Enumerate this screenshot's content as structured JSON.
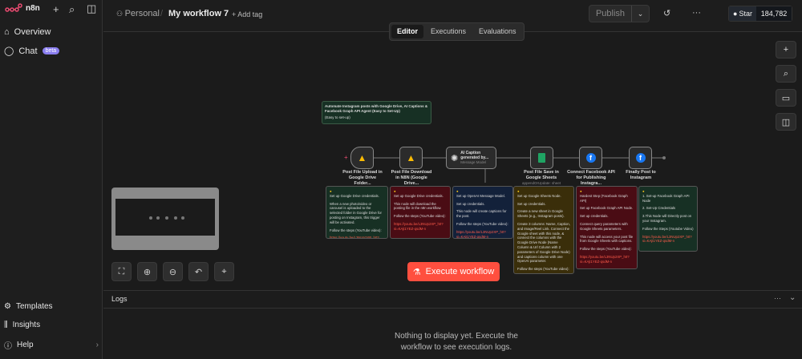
{
  "app": {
    "name": "n8n",
    "logo_color": "#ea4b71"
  },
  "sidebar": {
    "items": [
      {
        "label": "Overview",
        "icon": "home-icon"
      },
      {
        "label": "Chat",
        "icon": "chat-icon",
        "badge": "beta"
      }
    ],
    "bottom_items": [
      {
        "label": "Templates",
        "icon": "templates-icon"
      },
      {
        "label": "Insights",
        "icon": "insights-icon"
      },
      {
        "label": "Help",
        "icon": "help-icon"
      }
    ]
  },
  "header": {
    "project": "Personal",
    "separator": "/",
    "title": "My workflow 7",
    "add_tag": "+ Add tag",
    "publish": "Publish",
    "github_star": "Star",
    "star_count": "184,782"
  },
  "tabs": [
    {
      "label": "Editor",
      "active": true
    },
    {
      "label": "Executions"
    },
    {
      "label": "Evaluations"
    }
  ],
  "canvas": {
    "title_note": {
      "title": "Automate Instagram posts with Google Drive, AI Captions & Facebook Graph API Agent (Easy to Set-Up)",
      "sub": "(Easy to set-up)"
    },
    "nodes": [
      {
        "label": "Post File Upload in Google Drive Folder...",
        "sub": "fileCreated",
        "icon": "google-drive-icon"
      },
      {
        "label": "Post File Download in N8N (Google Drive...",
        "sub": "download: file",
        "icon": "google-drive-icon"
      },
      {
        "label": "AI Caption generated by...",
        "sub": "Message Model",
        "icon": "openai-icon"
      },
      {
        "label": "Post File Save in Google Sheets",
        "sub": "appendOrUpdate: sheet",
        "icon": "google-sheets-icon"
      },
      {
        "label": "Connect Facebook API for Publishing Instagra...",
        "sub": "",
        "icon": "facebook-icon"
      },
      {
        "label": "Finally Post to Instagram",
        "sub": "",
        "icon": "facebook-icon"
      }
    ],
    "notes": [
      {
        "color": "#173024",
        "lines": [
          "Set up Google Drive credentials.",
          "When a new photo/video or carousel is uploaded to the selected folder in Google Drive for posting on Instagram, this trigger will be activated.",
          "Follow the steps (YouTube video):"
        ],
        "link": "https://youtu.be/L3NUp2XP_h0?si=KAjt1YEZ-qsdM-n"
      },
      {
        "color": "#4a0c14",
        "lines": [
          "Set up Google Drive credentials.",
          "This node will download the posting file in the n8n workflow.",
          "Follow the steps (YouTube video):"
        ],
        "link": "https://youtu.be/L3NUp2XP_h0?si=KAjt1YEZ-qsdM-n"
      },
      {
        "color": "#13213a",
        "lines": [
          "Set up OpenAI Message Model.",
          "Set up credentials.",
          "This node will create captions for the post.",
          "Follow the steps (YouTube video):"
        ],
        "link": "https://youtu.be/L3NUp2XP_h0?si=KAjt1YEZ-qsdM-n"
      },
      {
        "color": "#3a2e0a",
        "lines": [
          "Set up Google Sheets Node.",
          "Set up credentials.",
          "Create a new sheet in Google Sheets (e.g., Instagram posts).",
          "Create 3 columns: Name, Caption, and Image/Reel Link. Connect the Google sheet with this node, & connect the columns with the Google Drive Node (Name Column & Url Column with 2 parameters of Google Drive Node) and captions column with one OpenAI parameter.",
          "Follow the steps (YouTube video):"
        ],
        "link": "https://youtu.be/L3NUp2XP_h0?si=KAjt1YEZ-qsdM-n"
      },
      {
        "color": "#4a0c14",
        "lines": [
          "Hardest Step (Facebook Graph API)",
          "Set up Facebook Graph API Node.",
          "Set up credentials.",
          "Connect query parameters with Google Sheets parameters.",
          "This node will access your post file from Google Sheets with captions.",
          "Follow the steps (YouTube video):"
        ],
        "link": "https://youtu.be/L3NUp2XP_h0?si=KAjt1YEZ-qsdM-n"
      },
      {
        "color": "#173024",
        "lines": [
          "1. Set-up Facebook Graph API Node",
          "2. Set-Up Credentials",
          "3.This Node will Directly post on your Instagram.",
          "Follow the Steps (Youtube Video)"
        ],
        "link": "https://youtu.be/L3NUp2XP_h0?si=KAjt1YEZ-qsdM-n"
      }
    ],
    "execute": "Execute workflow",
    "execute_color": "#ff4f3f"
  },
  "logs": {
    "title": "Logs",
    "empty": "Nothing to display yet. Execute the workflow to see execution logs."
  }
}
